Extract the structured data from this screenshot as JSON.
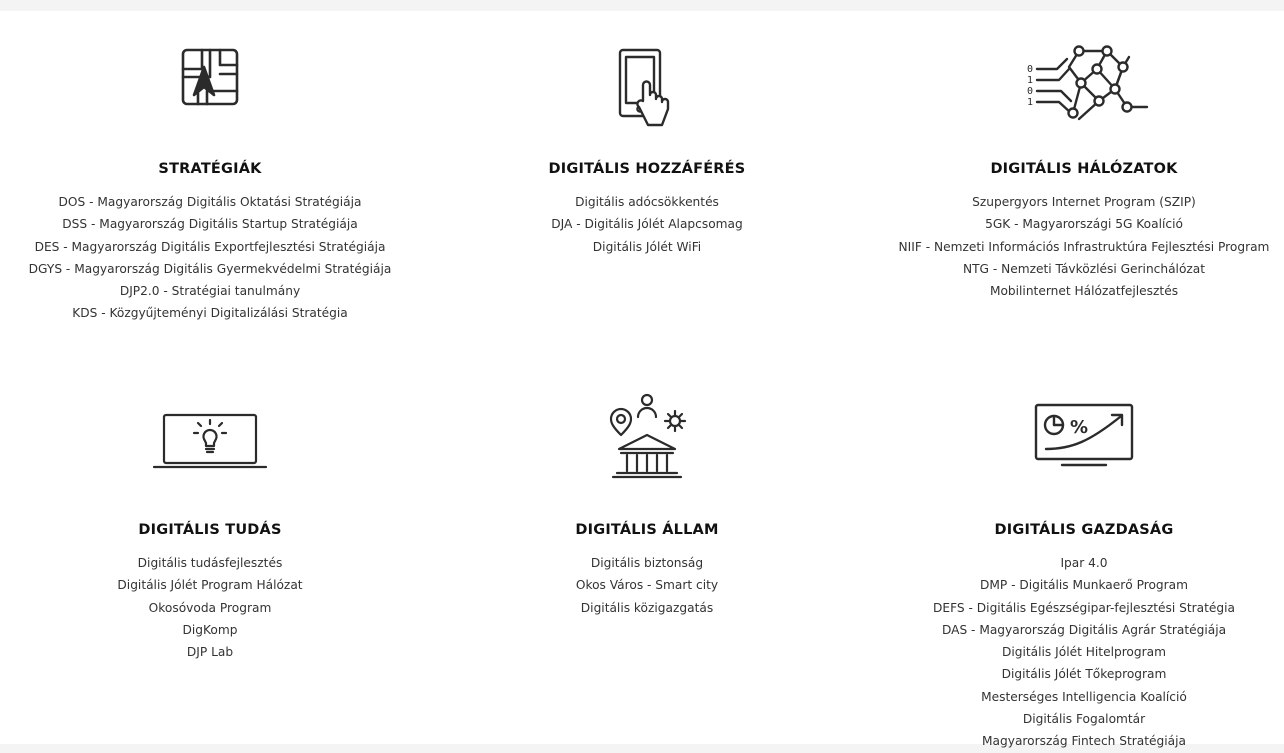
{
  "sections": [
    {
      "title": "STRATÉGIÁK",
      "icon": "strategy-map-icon",
      "links": [
        "DOS - Magyarország Digitális Oktatási Stratégiája",
        "DSS - Magyarország Digitális Startup Stratégiája",
        "DES - Magyarország Digitális Exportfejlesztési Stratégiája",
        "DGYS - Magyarország Digitális Gyermekvédelmi Stratégiája",
        "DJP2.0 - Stratégiai tanulmány",
        "KDS - Közgyűjteményi Digitalizálási Stratégia"
      ]
    },
    {
      "title": "DIGITÁLIS HOZZÁFÉRÉS",
      "icon": "tablet-touch-icon",
      "links": [
        "Digitális adócsökkentés",
        "DJA - Digitális Jólét Alapcsomag",
        "Digitális Jólét WiFi"
      ]
    },
    {
      "title": "DIGITÁLIS HÁLÓZATOK",
      "icon": "binary-network-icon",
      "links": [
        "Szupergyors Internet Program (SZIP)",
        "5GK - Magyarországi 5G Koalíció",
        "NIIF - Nemzeti Információs Infrastruktúra Fejlesztési Program",
        "NTG - Nemzeti Távközlési Gerinchálózat",
        "Mobilinternet Hálózatfejlesztés"
      ]
    },
    {
      "title": "DIGITÁLIS TUDÁS",
      "icon": "laptop-lightbulb-icon",
      "links": [
        "Digitális tudásfejlesztés",
        "Digitális Jólét Program Hálózat",
        "Okosóvoda Program",
        "DigKomp",
        "DJP Lab"
      ]
    },
    {
      "title": "DIGITÁLIS ÁLLAM",
      "icon": "government-building-icon",
      "links": [
        "Digitális biztonság",
        "Okos Város - Smart city",
        "Digitális közigazgatás"
      ]
    },
    {
      "title": "DIGITÁLIS GAZDASÁG",
      "icon": "monitor-growth-chart-icon",
      "links": [
        "Ipar 4.0",
        "DMP - Digitális Munkaerő Program",
        "DEFS - Digitális Egészségipar-fejlesztési Stratégia",
        "DAS - Magyarország Digitális Agrár Stratégiája",
        "Digitális Jólét Hitelprogram",
        "Digitális Jólét Tőkeprogram",
        "Mesterséges Intelligencia Koalíció",
        "Digitális Fogalomtár",
        "Magyarország Fintech Stratégiája"
      ]
    }
  ],
  "icon_labels": {
    "binary_digits": [
      "0",
      "1",
      "0",
      "1"
    ],
    "percent": "%"
  },
  "colors": {
    "background": "#f4f4f4",
    "panel": "#ffffff",
    "icon_stroke": "#2b2b2b",
    "text": "#333333",
    "title": "#111111"
  }
}
